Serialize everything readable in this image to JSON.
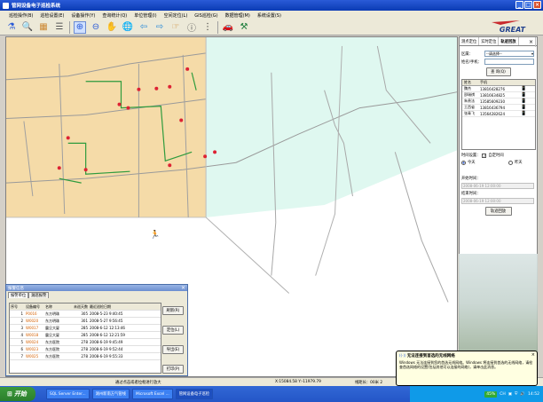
{
  "window": {
    "title": "管网设备电子巡检系统"
  },
  "menu": [
    "巡检操作(B)",
    "巡检设置(E)",
    "设备操作(Y)",
    "查询统计(Q)",
    "单位管理(I)",
    "空间定位(L)",
    "GIS巡检(G)",
    "数据管理(M)",
    "系统设置(S)"
  ],
  "logo": {
    "text": "GREAT"
  },
  "right_panel": {
    "tabs": [
      "测点定位",
      "实时定位",
      "轨迹回放"
    ],
    "region_label": "区属：",
    "region_value": "--请选择--",
    "name_label": "姓名/手机：",
    "query_button": "查 询(Q)",
    "table_headers": [
      "姓名",
      "手机"
    ],
    "users": [
      {
        "name": "魏杰",
        "phone": "13816428276"
      },
      {
        "name": "邵瑞祺",
        "phone": "13816634825"
      },
      {
        "name": "朱贵法",
        "phone": "13585609230"
      },
      {
        "name": "王西省",
        "phone": "13816436794"
      },
      {
        "name": "张青飞",
        "phone": "13564282624"
      }
    ],
    "time_setting_label": "时间设置：",
    "custom_time_label": "自定时间",
    "today_label": "今天",
    "yesterday_label": "昨天",
    "start_label": "开始时间：",
    "start_value": "2008-06-19 12:00:00",
    "end_label": "结束时间：",
    "end_value": "2008-06-19 12:00:00",
    "playback_button": "轨迹回放"
  },
  "alarm": {
    "title": "报警信息",
    "tabs": [
      "报警单位",
      "漏巡报警"
    ],
    "headers": [
      "序号",
      "设备编号",
      "名称",
      "未巡天数",
      "最近巡检日期"
    ],
    "rows": [
      {
        "no": "1",
        "id": "P0016",
        "name": "东方明珠",
        "days": "305",
        "date": "2008-5-23 9:40:45"
      },
      {
        "no": "2",
        "id": "W0020",
        "name": "东方明珠",
        "days": "301",
        "date": "2008-5-27 9:56:45"
      },
      {
        "no": "3",
        "id": "W0017",
        "name": "震旦大厦",
        "days": "285",
        "date": "2008-6-12 12:13:46"
      },
      {
        "no": "4",
        "id": "W0018",
        "name": "震旦大厦",
        "days": "285",
        "date": "2008-6-12 12:21:59"
      },
      {
        "no": "5",
        "id": "W0024",
        "name": "东方医院",
        "days": "278",
        "date": "2008-6-19 9:45:49"
      },
      {
        "no": "6",
        "id": "W0023",
        "name": "东方医院",
        "days": "278",
        "date": "2008-6-19 9:52:44"
      },
      {
        "no": "7",
        "id": "W0025",
        "name": "东方医院",
        "days": "278",
        "date": "2008-6-19 9:55:33"
      }
    ],
    "buttons": [
      "刷新(R)",
      "定位(L)",
      "导出(E)",
      "打印(P)"
    ]
  },
  "status": {
    "hint": "通过点击或者拉框进行放大",
    "coords": "X:15084.58 Y:-11979.79",
    "line": "线距长：00米 2",
    "total": "总面积：00米 2",
    "count": "00米 2"
  },
  "taskbar": {
    "start": "开始",
    "tasks": [
      "SQL Server Enter...",
      "湖州新南方气管线",
      "Microsoft Excel ...",
      "管网设备电子巡检"
    ],
    "clock": "14:52",
    "percent": "45%",
    "volume_label": "CH"
  },
  "balloon": {
    "title": "无法连接到首选的无线网络",
    "body": "Windows 无法连接到您的首选无线网络。Windows 将连接到首选的无线网络，请检查首选网络的设置(包括其他可以连接的网络)，请单击此消息。"
  }
}
